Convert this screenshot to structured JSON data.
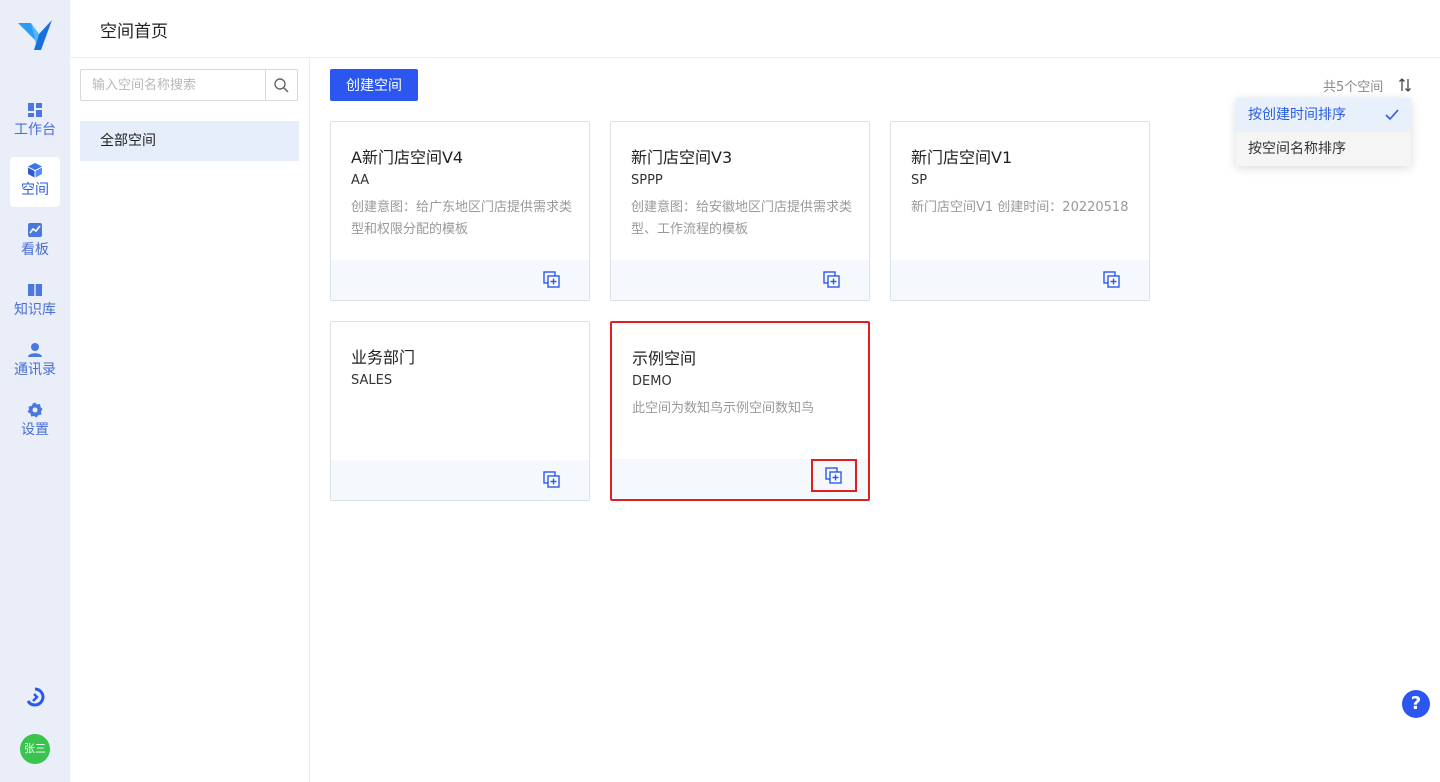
{
  "header": {
    "title": "空间首页"
  },
  "nav": {
    "items": [
      {
        "label": "工作台",
        "icon": "dashboard-icon"
      },
      {
        "label": "空间",
        "icon": "cube-icon"
      },
      {
        "label": "看板",
        "icon": "chart-icon"
      },
      {
        "label": "知识库",
        "icon": "book-icon"
      },
      {
        "label": "通讯录",
        "icon": "user-icon"
      },
      {
        "label": "设置",
        "icon": "gear-icon"
      }
    ],
    "active_index": 1,
    "avatar_text": "张三"
  },
  "sidebar": {
    "search_placeholder": "输入空间名称搜索",
    "items": [
      {
        "label": "全部空间"
      }
    ]
  },
  "toolbar": {
    "create_label": "创建空间",
    "count_text": "共5个空间"
  },
  "sort_menu": {
    "items": [
      {
        "label": "按创建时间排序",
        "selected": true
      },
      {
        "label": "按空间名称排序",
        "selected": false
      }
    ]
  },
  "cards": [
    {
      "title": "A新门店空间V4",
      "code": "AA",
      "desc": "创建意图：给广东地区门店提供需求类型和权限分配的模板"
    },
    {
      "title": "新门店空间V3",
      "code": "SPPP",
      "desc": "创建意图：给安徽地区门店提供需求类型、工作流程的模板"
    },
    {
      "title": "新门店空间V1",
      "code": "SP",
      "desc": "新门店空间V1 创建时间：20220518"
    },
    {
      "title": "业务部门",
      "code": "SALES",
      "desc": ""
    },
    {
      "title": "示例空间",
      "code": "DEMO",
      "desc": "此空间为数知鸟示例空间数知鸟"
    }
  ],
  "help": {
    "label": "?"
  },
  "colors": {
    "primary": "#2b57f0",
    "highlight": "#e02020",
    "rail_bg": "#e9eef9"
  }
}
